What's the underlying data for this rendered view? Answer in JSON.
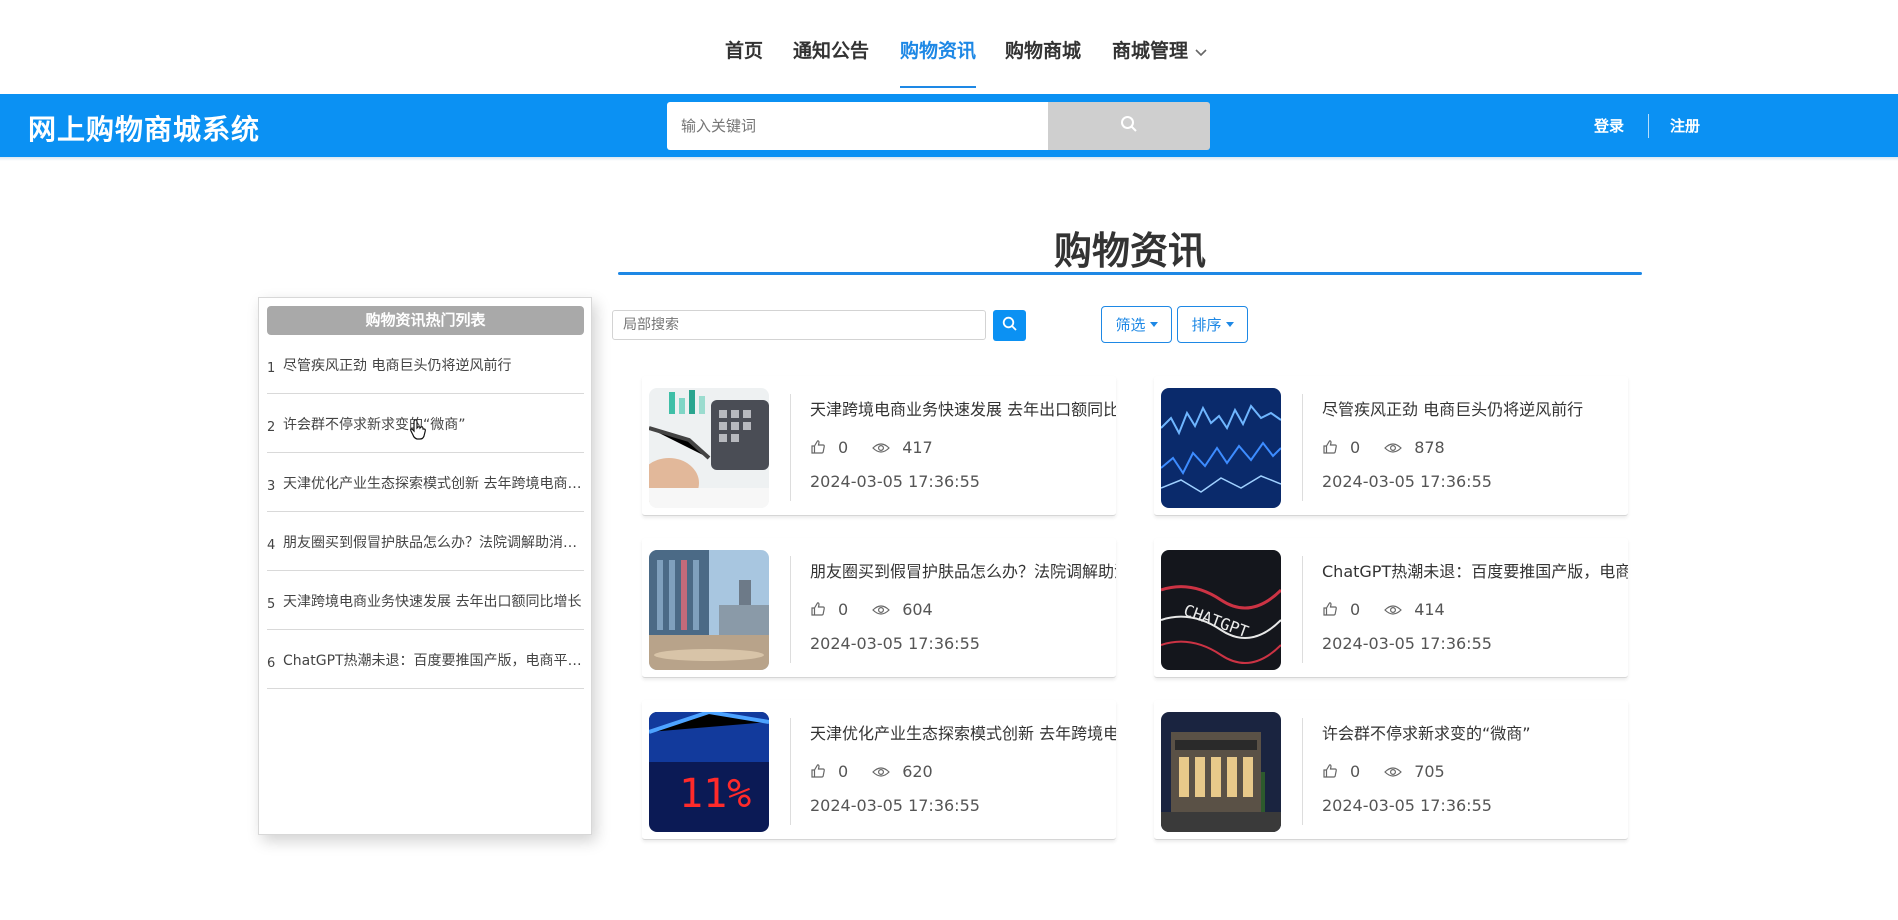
{
  "nav": {
    "items": [
      {
        "label": "首页"
      },
      {
        "label": "通知公告"
      },
      {
        "label": "购物资讯"
      },
      {
        "label": "购物商城"
      },
      {
        "label": "商城管理"
      }
    ]
  },
  "header": {
    "site_title": "网上购物商城系统",
    "search_placeholder": "输入关键词",
    "login_label": "登录",
    "register_label": "注册"
  },
  "section": {
    "title": "购物资讯"
  },
  "hot_list": {
    "header": "购物资讯热门列表",
    "items": [
      {
        "num": "1",
        "title": "尽管疾风正劲 电商巨头仍将逆风前行"
      },
      {
        "num": "2",
        "title": "许会群不停求新求变的“微商”"
      },
      {
        "num": "3",
        "title": "天津优化产业生态探索模式创新 去年跨境电商进出口规模同比增长"
      },
      {
        "num": "4",
        "title": "朋友圈买到假冒护肤品怎么办？法院调解助消费者维权"
      },
      {
        "num": "5",
        "title": "天津跨境电商业务快速发展 去年出口额同比增长"
      },
      {
        "num": "6",
        "title": "ChatGPT热潮未退：百度要推国产版，电商平台纷纷布局"
      }
    ]
  },
  "toolbar": {
    "local_search_placeholder": "局部搜索",
    "filter_label": "筛选",
    "sort_label": "排序"
  },
  "cards": [
    {
      "title": "天津跨境电商业务快速发展 去年出口额同比增长",
      "likes": "0",
      "views": "417",
      "date": "2024-03-05 17:36:55",
      "thumb": "calculator-chart-image"
    },
    {
      "title": "尽管疾风正劲 电商巨头仍将逆风前行",
      "likes": "0",
      "views": "878",
      "date": "2024-03-05 17:36:55",
      "thumb": "stock-line-image"
    },
    {
      "title": "朋友圈买到假冒护肤品怎么办？法院调解助消费者维权",
      "likes": "0",
      "views": "604",
      "date": "2024-03-05 17:36:55",
      "thumb": "building-street-image"
    },
    {
      "title": "ChatGPT热潮未退：百度要推国产版，电商平台纷纷布局",
      "likes": "0",
      "views": "414",
      "date": "2024-03-05 17:36:55",
      "thumb": "chatgpt-chart-image"
    },
    {
      "title": "天津优化产业生态探索模式创新 去年跨境电商进出口规模同比增长",
      "likes": "0",
      "views": "620",
      "date": "2024-03-05 17:36:55",
      "thumb": "red-ticker-image"
    },
    {
      "title": "许会群不停求新求变的“微商”",
      "likes": "0",
      "views": "705",
      "date": "2024-03-05 17:36:55",
      "thumb": "mall-night-image"
    }
  ],
  "colors": {
    "accent": "#0b91f3",
    "nav_active": "#1e88e5"
  }
}
